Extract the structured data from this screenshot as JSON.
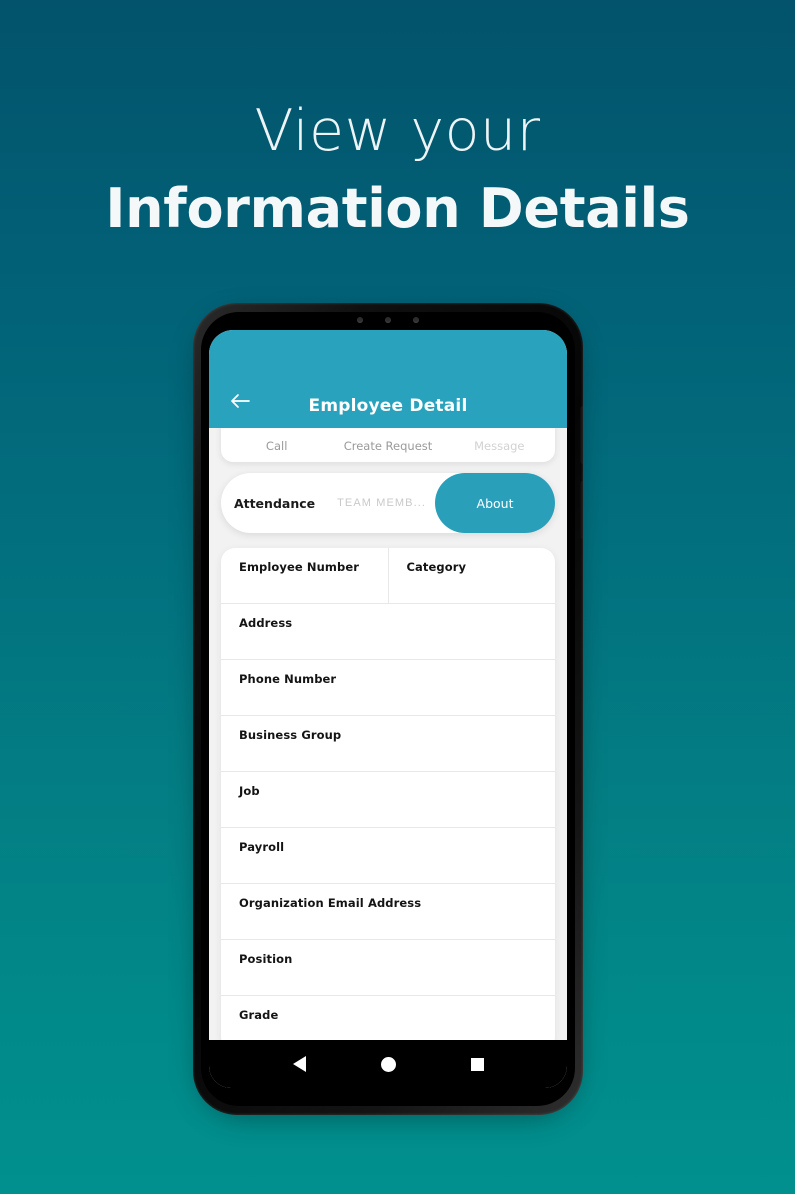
{
  "poster": {
    "headline_light": "View your",
    "headline_bold": "Information Details",
    "background_gradient_top": "#02536b",
    "background_gradient_bottom": "#01908e"
  },
  "app": {
    "accent_color": "#29a2be",
    "appbar": {
      "title": "Employee Detail",
      "back_icon": "arrow-left-icon"
    },
    "action_row": [
      {
        "label": "Call",
        "muted": false
      },
      {
        "label": "Create Request",
        "muted": false
      },
      {
        "label": "Message",
        "muted": true
      }
    ],
    "tabs": [
      {
        "label": "Attendance",
        "state": "inactive-bold"
      },
      {
        "label": "TEAM MEMB...",
        "state": "inactive-muted"
      },
      {
        "label": "About",
        "state": "active"
      }
    ],
    "info_rows": [
      {
        "split": true,
        "cells": [
          {
            "label": "Employee Number",
            "value": ""
          },
          {
            "label": "Category",
            "value": ""
          }
        ]
      },
      {
        "split": false,
        "cells": [
          {
            "label": "Address",
            "value": ""
          }
        ]
      },
      {
        "split": false,
        "cells": [
          {
            "label": "Phone Number",
            "value": ""
          }
        ]
      },
      {
        "split": false,
        "cells": [
          {
            "label": "Business Group",
            "value": ""
          }
        ]
      },
      {
        "split": false,
        "cells": [
          {
            "label": "Job",
            "value": ""
          }
        ]
      },
      {
        "split": false,
        "cells": [
          {
            "label": "Payroll",
            "value": ""
          }
        ]
      },
      {
        "split": false,
        "cells": [
          {
            "label": "Organization Email Address",
            "value": ""
          }
        ]
      },
      {
        "split": false,
        "cells": [
          {
            "label": "Position",
            "value": ""
          }
        ]
      },
      {
        "split": false,
        "cells": [
          {
            "label": "Grade",
            "value": ""
          }
        ]
      }
    ],
    "navbar": {
      "back": "triangle-back-icon",
      "home": "circle-home-icon",
      "recents": "square-recents-icon"
    }
  }
}
